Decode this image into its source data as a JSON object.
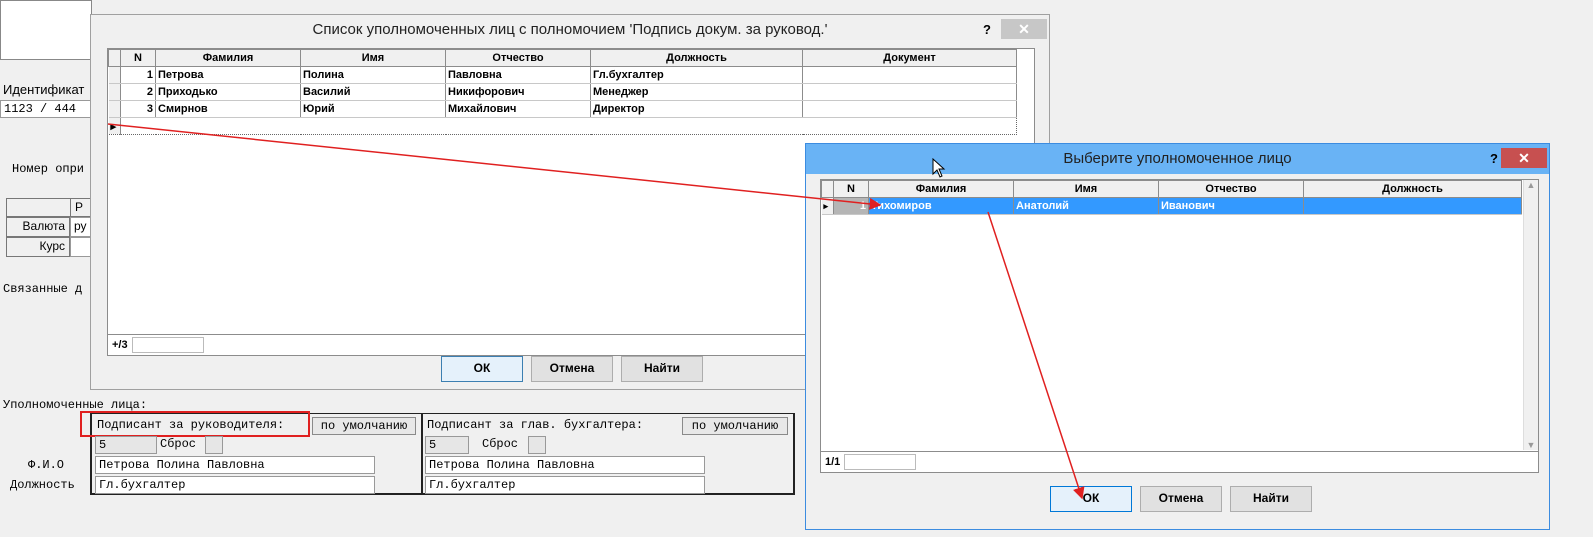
{
  "background_form": {
    "identifier_label": "Идентификат",
    "identifier_value": "1123 / 444",
    "number_label": "Номер опри",
    "currency_header": "Р",
    "currency_label": "Валюта",
    "currency_value": "ру",
    "rate_label": "Курс",
    "related_label": "Связанные д",
    "authorized_label": "Уполномоченные лица:",
    "signer_head_label": "Подписант за руководителя:",
    "signer_head_default_btn": "по умолчанию",
    "signer_head_code": "5",
    "signer_head_reset": "Сброс",
    "signer_head_fio": "Петрова Полина Павловна",
    "signer_head_position": "Гл.бухгалтер",
    "signer_acc_label": "Подписант за глав. бухгалтера:",
    "signer_acc_default_btn": "по умолчанию",
    "signer_acc_code": "5",
    "signer_acc_reset": "Сброс",
    "signer_acc_fio": "Петрова Полина Павловна",
    "signer_acc_position": "Гл.бухгалтер",
    "fio_label": "Ф.И.О",
    "position_label": "Должность"
  },
  "dialog_list": {
    "title": "Список уполномоченных лиц с полномочием 'Подпись докум. за руковод.'",
    "help": "?",
    "close": "✕",
    "columns": [
      "N",
      "Фамилия",
      "Имя",
      "Отчество",
      "Должность",
      "Документ"
    ],
    "rows": [
      [
        "1",
        "Петрова",
        "Полина",
        "Павловна",
        "Гл.бухгалтер",
        ""
      ],
      [
        "2",
        "Приходько",
        "Василий",
        "Никифорович",
        "Менеджер",
        ""
      ],
      [
        "3",
        "Смирнов",
        "Юрий",
        "Михайлович",
        "Директор",
        ""
      ]
    ],
    "status": "+/3",
    "ok": "ОК",
    "cancel": "Отмена",
    "find": "Найти"
  },
  "dialog_select": {
    "title": "Выберите уполномоченное лицо",
    "help": "?",
    "close": "✕",
    "columns": [
      "N",
      "Фамилия",
      "Имя",
      "Отчество",
      "Должность"
    ],
    "rows": [
      [
        "1",
        "Тихомиров",
        "Анатолий",
        "Иванович",
        ""
      ]
    ],
    "status": "1/1",
    "ok": "ОК",
    "cancel": "Отмена",
    "find": "Найти"
  },
  "colors": {
    "highlight_box": "#e02020",
    "arrow": "#e02020",
    "selection": "#3399ff",
    "active_titlebar": "#69b3f5"
  }
}
